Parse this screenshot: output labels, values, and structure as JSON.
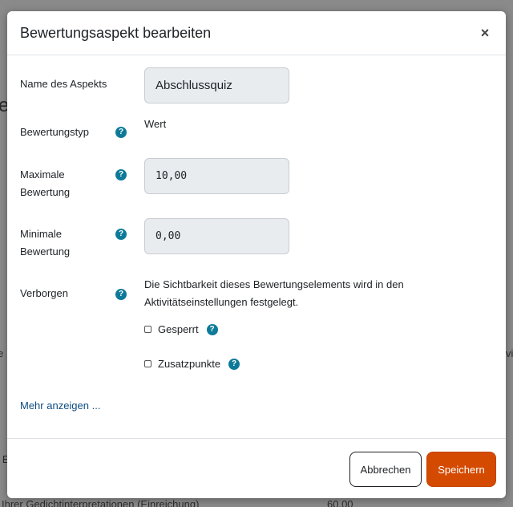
{
  "background": {
    "left_heading_fragment": "e",
    "fragment_a": "e",
    "fragment_b": "vi",
    "fragment_c": "n E",
    "fragment_d": "Ihrer Gedichtinterpretationen (Einreichung)",
    "fragment_e": "60,00"
  },
  "modal": {
    "title": "Bewertungsaspekt bearbeiten",
    "close_label": "×",
    "fields": {
      "name": {
        "label": "Name des Aspekts",
        "value": "Abschlussquiz"
      },
      "type": {
        "label": "Bewertungstyp",
        "value": "Wert"
      },
      "max": {
        "label_line1": "Maximale",
        "label_line2": "Bewertung",
        "value": "10,00"
      },
      "min": {
        "label_line1": "Minimale",
        "label_line2": "Bewertung",
        "value": "0,00"
      },
      "hidden": {
        "label": "Verborgen",
        "info_line1": "Die Sichtbarkeit dieses Bewertungselements wird in den",
        "info_line2": "Aktivitätseinstellungen festgelegt."
      },
      "locked": {
        "label": "Gesperrt",
        "checked": false
      },
      "extra": {
        "label": "Zusatzpunkte",
        "checked": false
      }
    },
    "help_glyph": "?",
    "more_link": "Mehr anzeigen ...",
    "footer": {
      "cancel_label": "Abbrechen",
      "save_label": "Speichern"
    }
  },
  "colors": {
    "primary_button": "#d44a00",
    "help_icon": "#0d7a99",
    "link": "#0f4c81"
  }
}
